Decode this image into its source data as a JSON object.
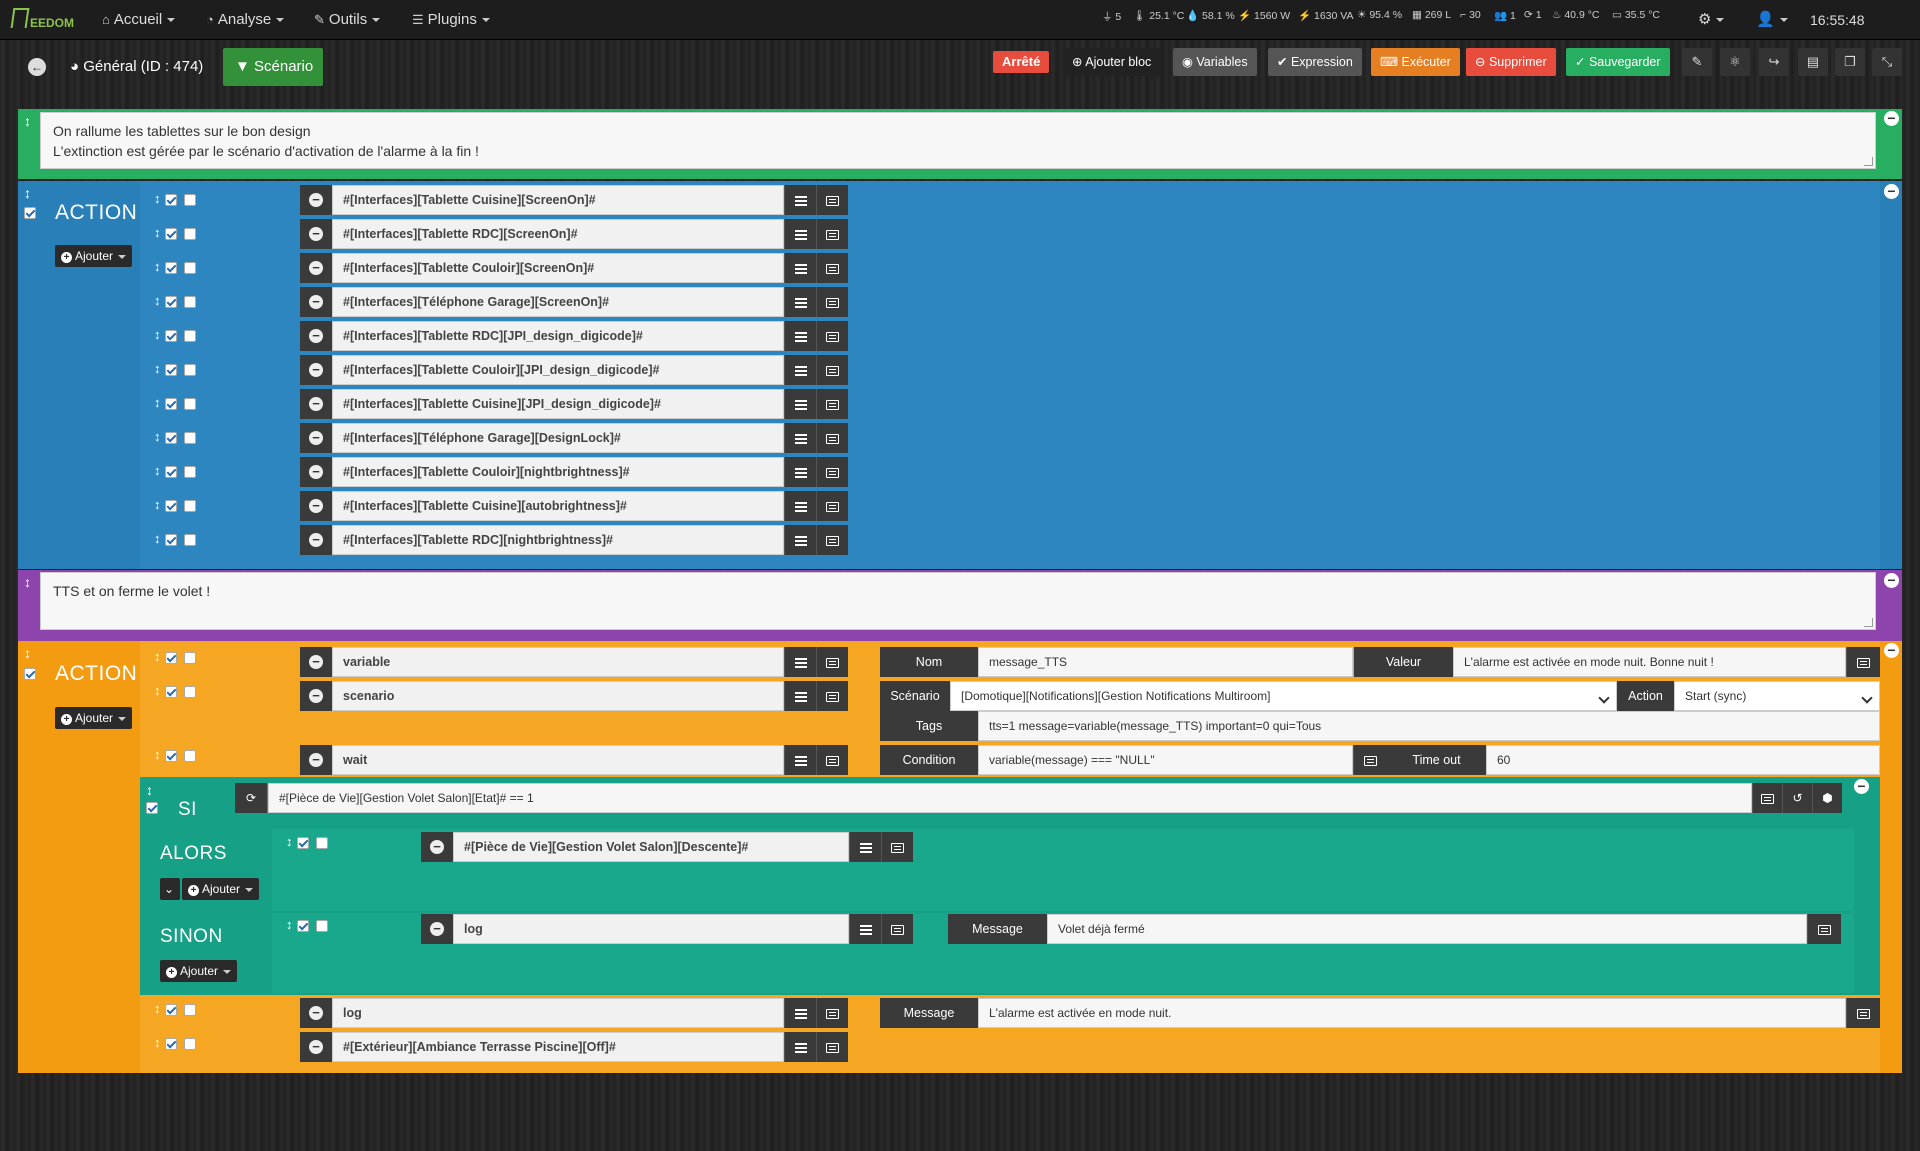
{
  "nav": {
    "logo": "EEDOM",
    "menus": [
      {
        "label": "Accueil",
        "icon": "home-icon"
      },
      {
        "label": "Analyse",
        "icon": "dashboard-icon"
      },
      {
        "label": "Outils",
        "icon": "wrench-icon"
      },
      {
        "label": "Plugins",
        "icon": "list-icon"
      }
    ],
    "stats": [
      "5",
      "25.1 °C",
      "58.1 %",
      "1560 W",
      "1630 VA",
      "95.4 %",
      "269 L",
      "30",
      "1",
      "1",
      "40.9 °C",
      "35.5 °C"
    ],
    "time": "16:55:48"
  },
  "header": {
    "general_tab": "Général (ID : 474)",
    "scenario_tab": "Scénario",
    "status": "Arrêté",
    "buttons": {
      "add_block": "Ajouter bloc",
      "variables": "Variables",
      "expression": "Expression",
      "execute": "Exécuter",
      "delete": "Supprimer",
      "save": "Sauvegarder"
    }
  },
  "colors": {
    "green": "#27ae60",
    "blue": "#2980b9",
    "purple": "#8e44ad",
    "orange": "#f39c12",
    "teal": "#16a085",
    "status_red": "#e74c3c"
  },
  "comment1": {
    "line1": "On rallume les tablettes sur le bon design",
    "line2": "L'extinction est gérée par le scénario d'activation de l'alarme à la fin !"
  },
  "action1": {
    "label": "ACTION",
    "add_label": "Ajouter",
    "commands": [
      "#[Interfaces][Tablette Cuisine][ScreenOn]#",
      "#[Interfaces][Tablette RDC][ScreenOn]#",
      "#[Interfaces][Tablette Couloir][ScreenOn]#",
      "#[Interfaces][Téléphone Garage][ScreenOn]#",
      "#[Interfaces][Tablette RDC][JPI_design_digicode]#",
      "#[Interfaces][Tablette Couloir][JPI_design_digicode]#",
      "#[Interfaces][Tablette Cuisine][JPI_design_digicode]#",
      "#[Interfaces][Téléphone Garage][DesignLock]#",
      "#[Interfaces][Tablette Couloir][nightbrightness]#",
      "#[Interfaces][Tablette Cuisine][autobrightness]#",
      "#[Interfaces][Tablette RDC][nightbrightness]#"
    ]
  },
  "comment2": {
    "text": "TTS et on ferme le volet !"
  },
  "action2": {
    "label": "ACTION",
    "add_label": "Ajouter",
    "variable": {
      "cmd": "variable",
      "name_label": "Nom",
      "name_value": "message_TTS",
      "value_label": "Valeur",
      "value_value": "L'alarme est activée en mode nuit. Bonne nuit !"
    },
    "scenario": {
      "cmd": "scenario",
      "label": "Scénario",
      "value": "[Domotique][Notifications][Gestion Notifications Multiroom]",
      "action_label": "Action",
      "action_value": "Start (sync)",
      "tags_label": "Tags",
      "tags_value": "tts=1 message=variable(message_TTS) important=0 qui=Tous"
    },
    "wait": {
      "cmd": "wait",
      "condition_label": "Condition",
      "condition_value": "variable(message) === \"NULL\"",
      "timeout_label": "Time out",
      "timeout_value": "60"
    },
    "if": {
      "label": "SI",
      "condition": "#[Pièce de Vie][Gestion Volet Salon][Etat]# == 1",
      "then_label": "ALORS",
      "then_add": "Ajouter",
      "then_cmd": "#[Pièce de Vie][Gestion Volet Salon][Descente]#",
      "else_label": "SINON",
      "else_add": "Ajouter",
      "else_cmd": "log",
      "else_msg_label": "Message",
      "else_msg_value": "Volet déjà fermé"
    },
    "log": {
      "cmd": "log",
      "msg_label": "Message",
      "msg_value": "L'alarme est activée en mode nuit."
    },
    "last_cmd": "#[Extérieur][Ambiance Terrasse Piscine][Off]#"
  }
}
